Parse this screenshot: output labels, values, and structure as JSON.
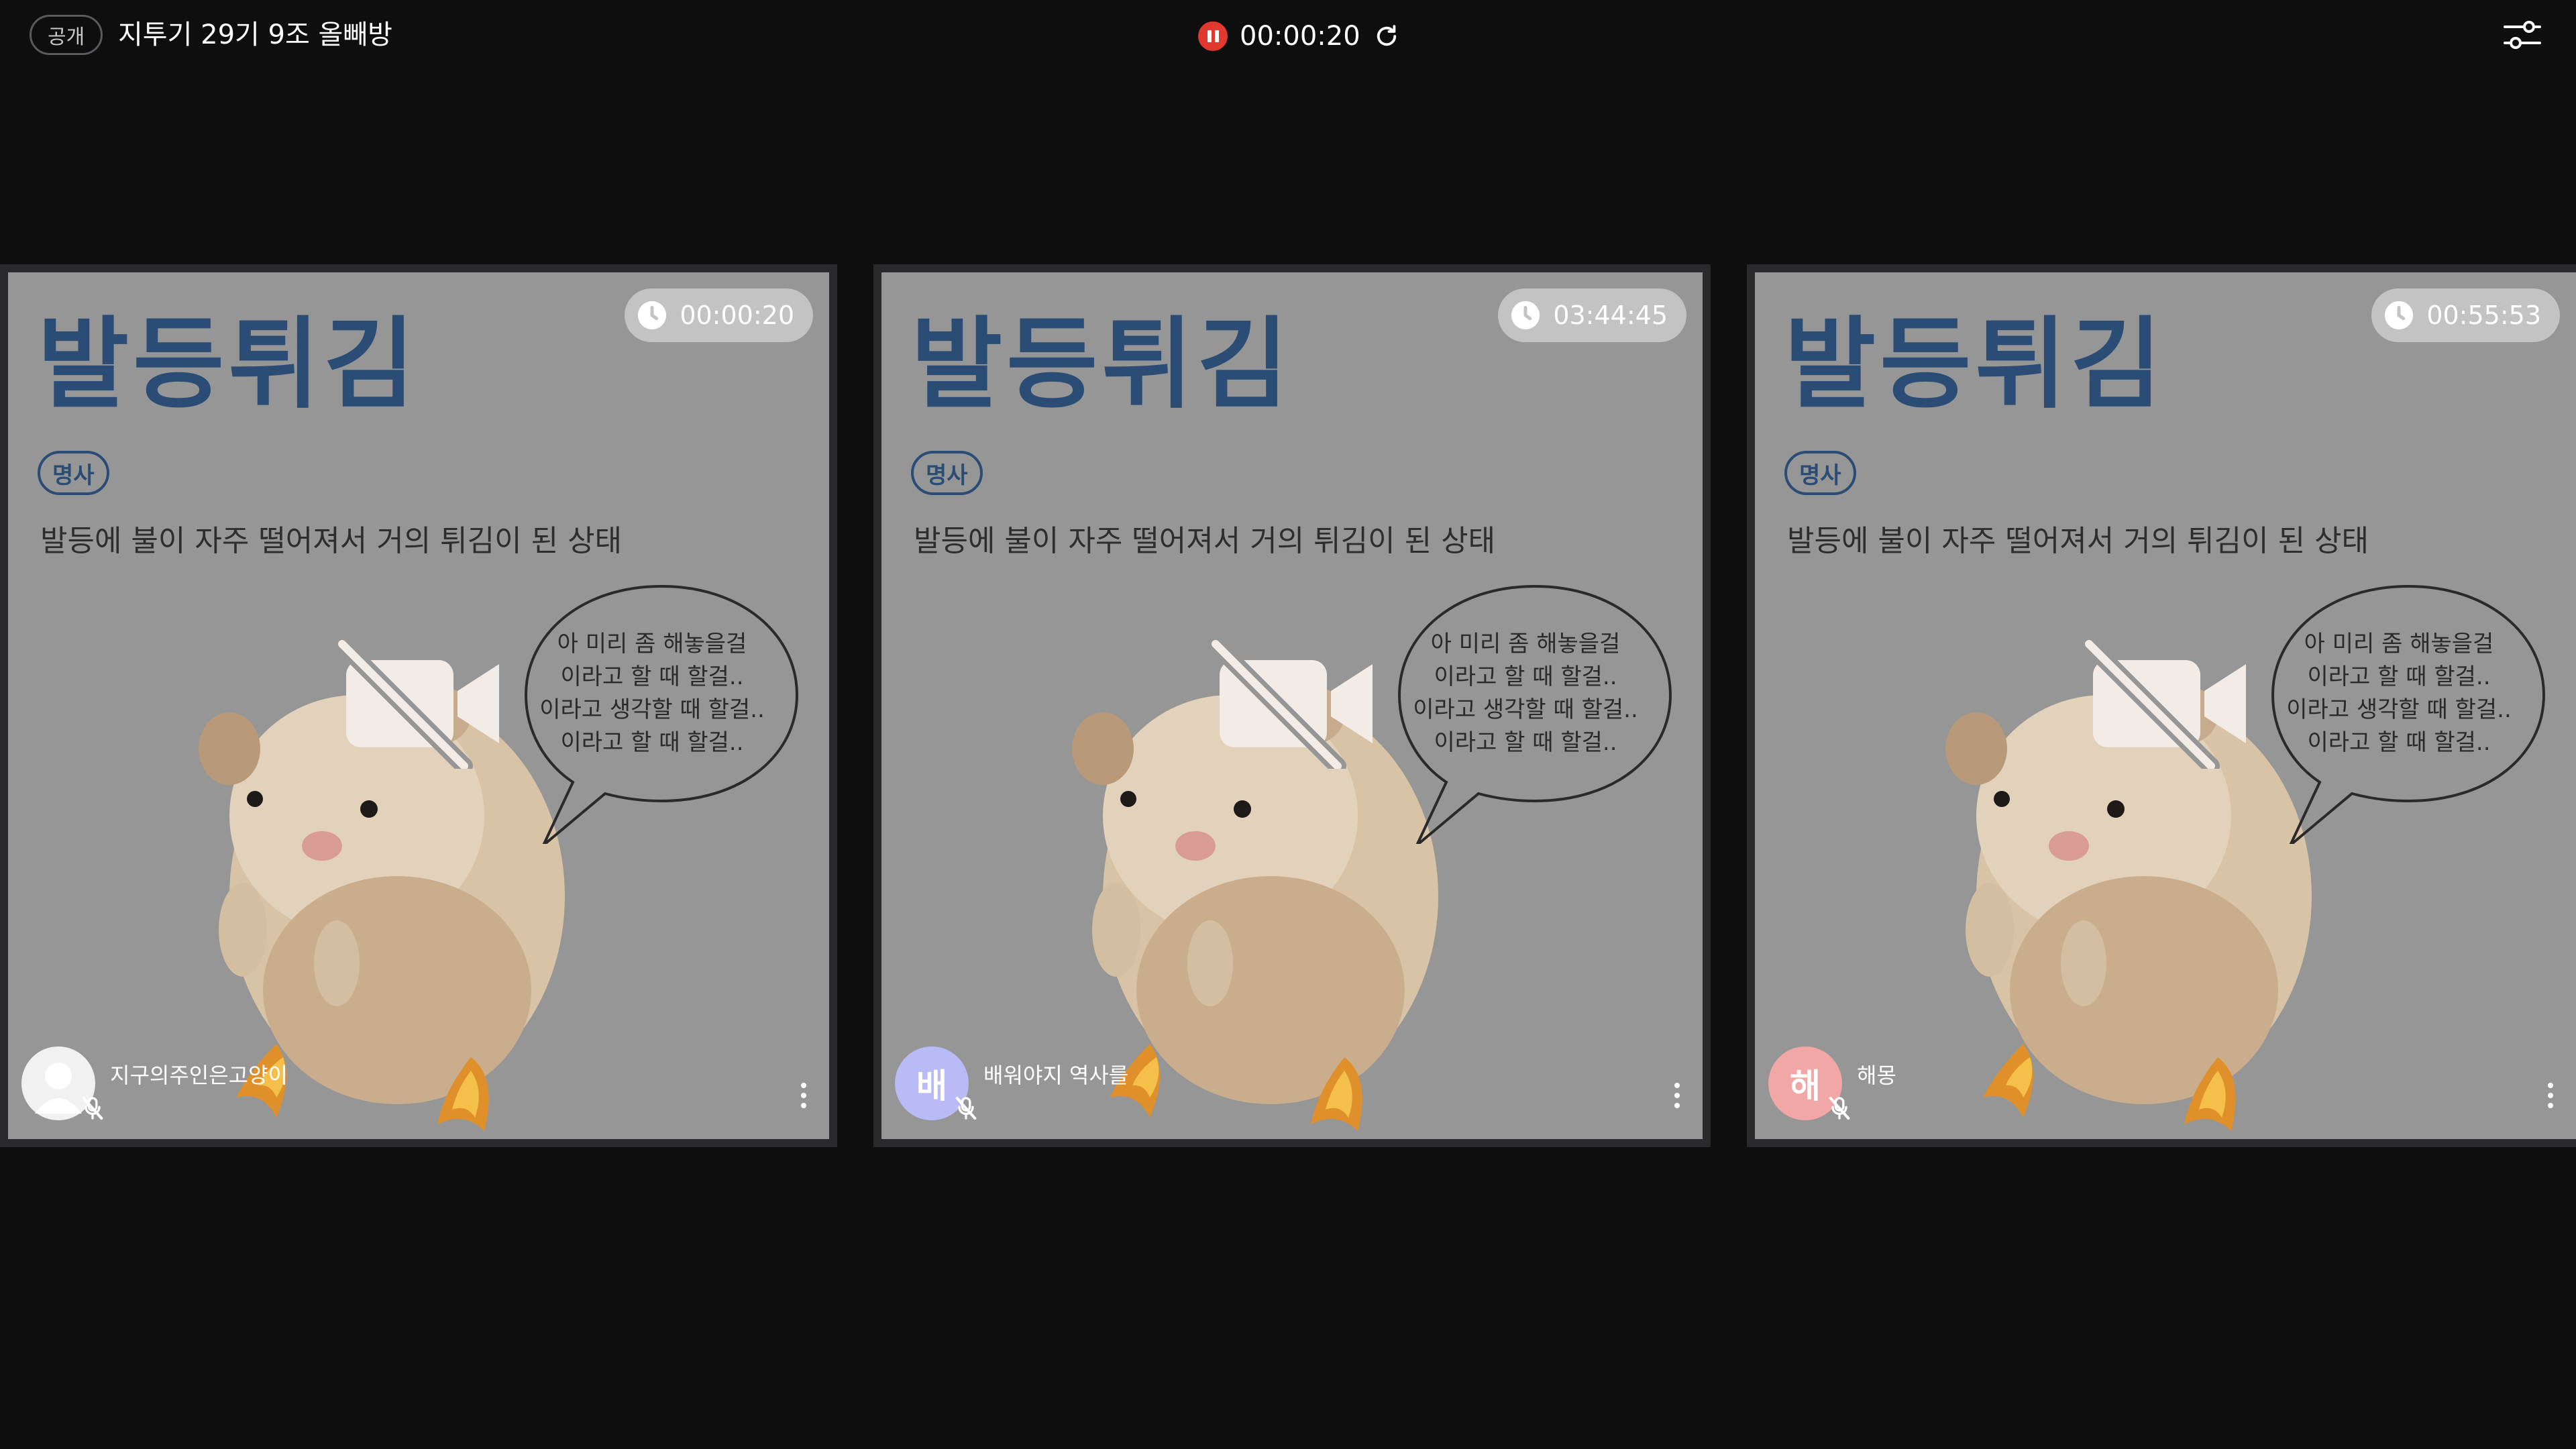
{
  "header": {
    "visibility_badge": "공개",
    "room_title": "지투기 29기 9조 올빼방",
    "session_timer": "00:00:20",
    "icons": [
      "pause-record-icon",
      "refresh-icon",
      "settings-sliders-icon"
    ]
  },
  "card": {
    "word": "발등튀김",
    "part_of_speech": "명사",
    "definition": "발등에 불이 자주 떨어져서 거의 튀김이 된 상태",
    "speech_lines": [
      "아 미리 좀 해놓을걸",
      "이라고 할 때 할걸..",
      "이라고 생각할 때 할걸..",
      "이라고 할 때 할걸.."
    ]
  },
  "participants": [
    {
      "name": "지구의주인은고양이",
      "timer": "00:00:20",
      "avatar_initial": "",
      "avatar_color": "#f1f1f1",
      "camera": "off",
      "mic": "off"
    },
    {
      "name": "배워야지 역사를",
      "timer": "03:44:45",
      "avatar_initial": "배",
      "avatar_color": "#b8bbf5",
      "camera": "off",
      "mic": "off"
    },
    {
      "name": "해몽",
      "timer": "00:55:53",
      "avatar_initial": "해",
      "avatar_color": "#f0a7a6",
      "camera": "off",
      "mic": "off"
    }
  ],
  "colors": {
    "background": "#0e0e0f",
    "tile_fill": "#969696",
    "word_blue": "#2b4d75",
    "record_red": "#e2392f"
  }
}
